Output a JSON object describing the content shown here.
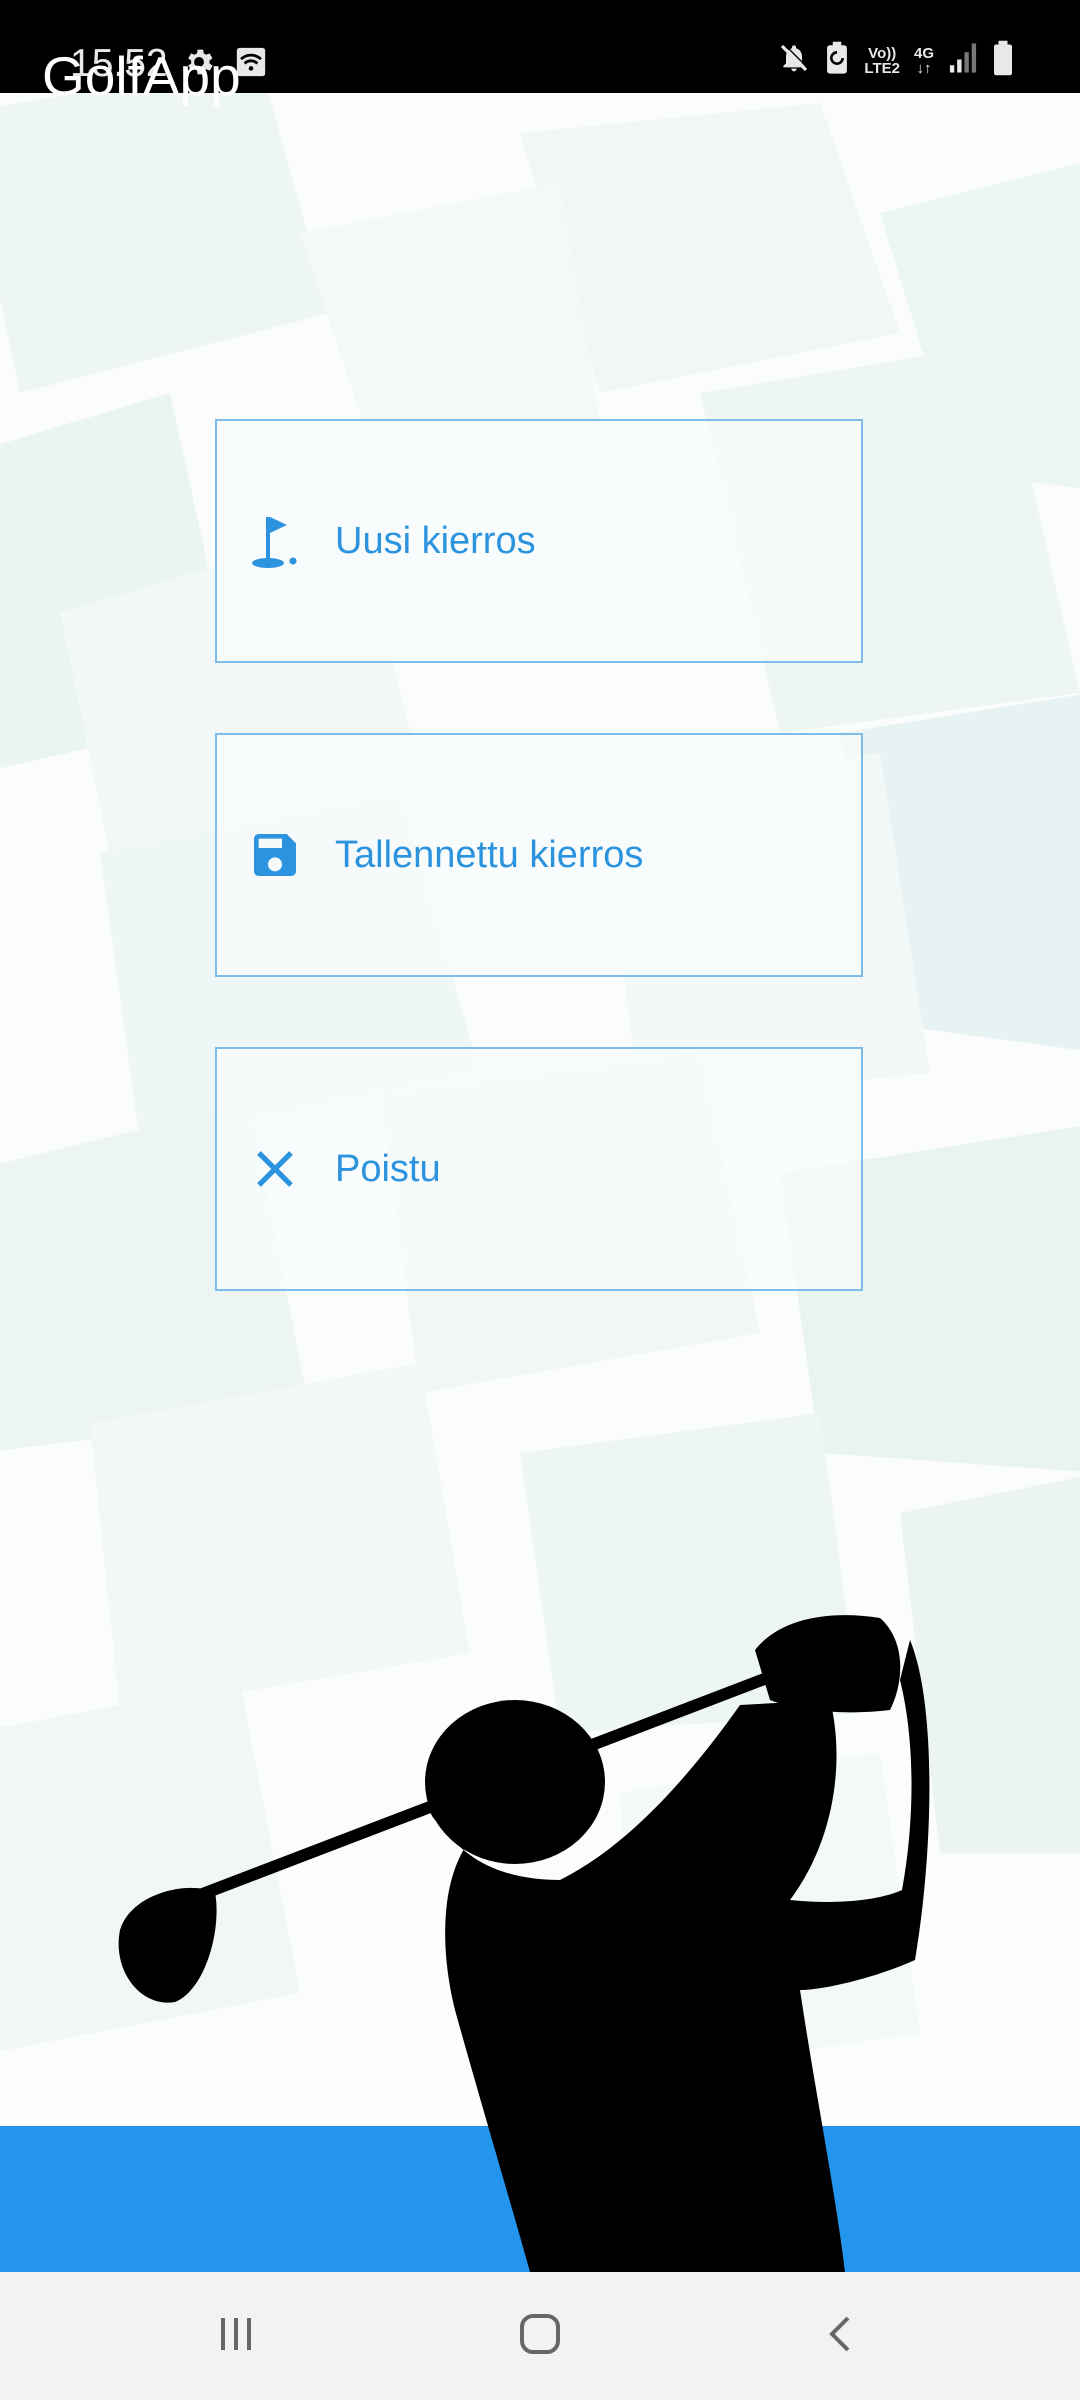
{
  "status_bar": {
    "time": "15.52",
    "network_top": "Vo))",
    "network_bottom": "LTE2",
    "data_type": "4G",
    "icons": [
      "settings-icon",
      "wifi-call-icon",
      "mute-icon",
      "battery-saver-icon",
      "signal-icon",
      "battery-icon"
    ]
  },
  "menu": {
    "items": [
      {
        "label": "Uusi kierros",
        "icon": "golf-flag-icon"
      },
      {
        "label": "Tallennettu kierros",
        "icon": "save-icon"
      },
      {
        "label": "Poistu",
        "icon": "close-icon"
      }
    ]
  },
  "app_bar": {
    "title": "GolfApp"
  },
  "nav_bar": {
    "icons": [
      "recent-apps-icon",
      "home-icon",
      "back-icon"
    ]
  },
  "colors": {
    "accent": "#2395ec",
    "button_text": "#2c93df",
    "button_border": "#7fbde8",
    "status_bar_bg": "#000000",
    "nav_bar_bg": "#f2f2f2"
  }
}
